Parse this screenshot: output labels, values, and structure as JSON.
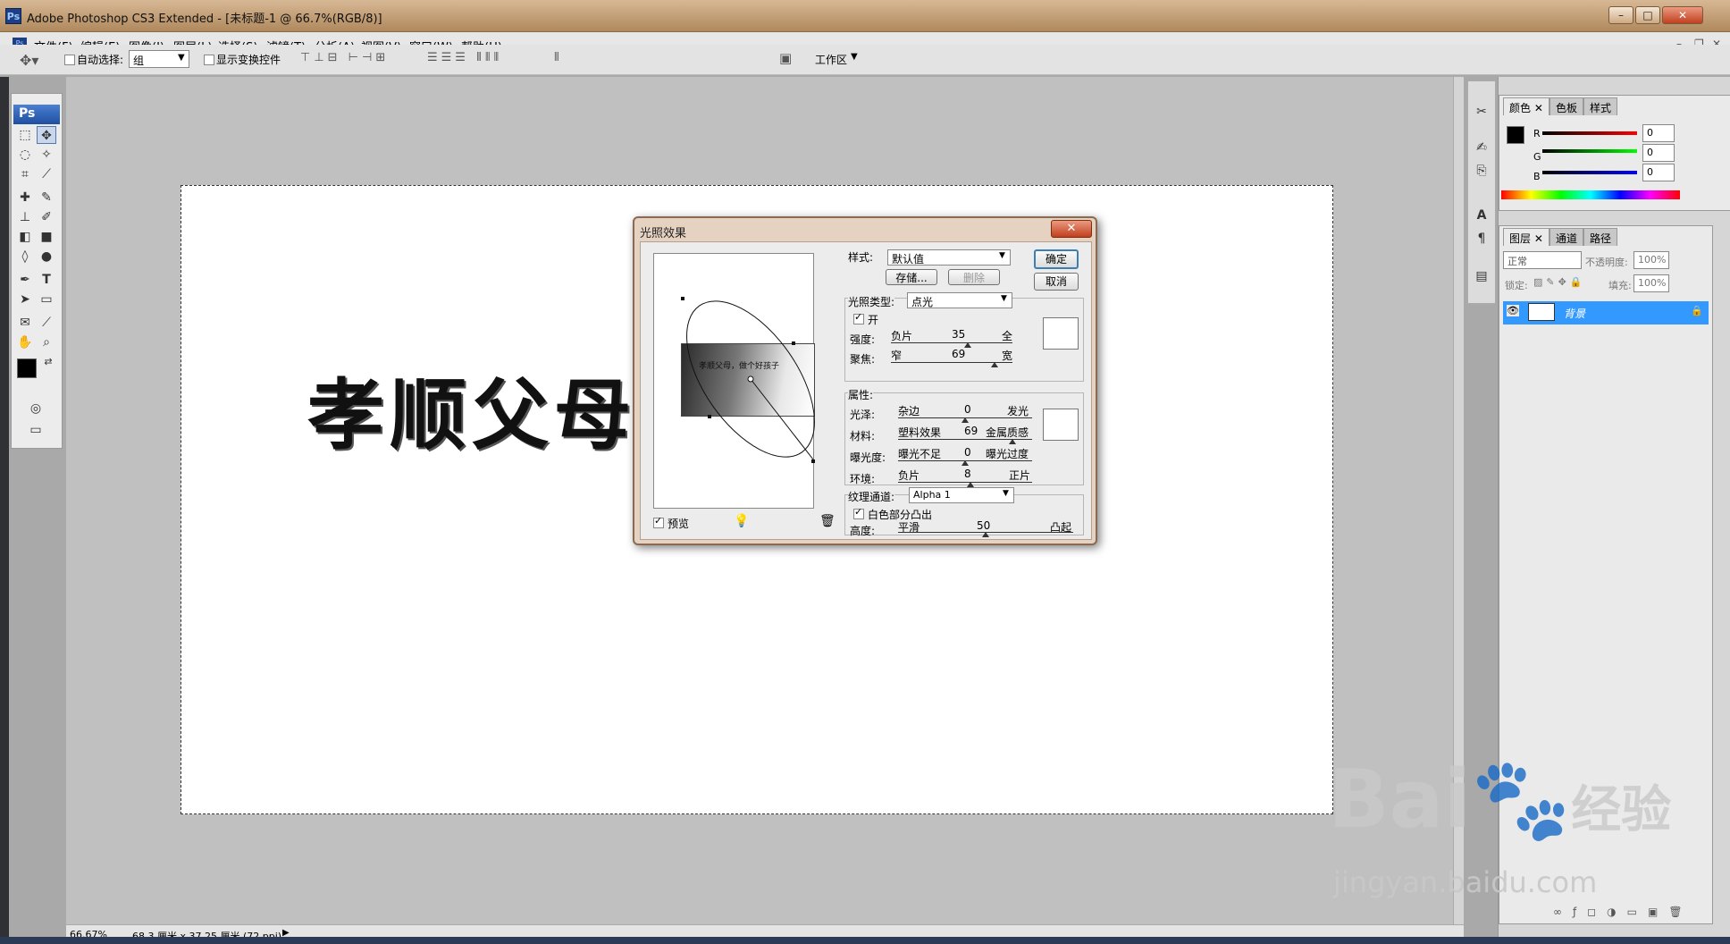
{
  "window": {
    "title": "Adobe Photoshop CS3 Extended - [未标题-1 @ 66.7%(RGB/8)]",
    "min": "–",
    "max": "□",
    "close": "✕"
  },
  "menu": [
    "文件(F)",
    "编辑(E)",
    "图像(I)",
    "图层(L)",
    "选择(S)",
    "滤镜(T)",
    "分析(A)",
    "视图(V)",
    "窗口(W)",
    "帮助(H)"
  ],
  "options": {
    "auto_select_label": "自动选择:",
    "auto_select_value": "组",
    "show_transform_label": "显示变换控件",
    "workspace_label": "工作区"
  },
  "toolbox": {
    "logo": "Ps"
  },
  "document": {
    "text": "孝顺父母"
  },
  "dialog": {
    "title": "光照效果",
    "preview_text": "孝顺父母，做个好孩子",
    "preview_label": "预览",
    "style_label": "样式:",
    "style_value": "默认值",
    "save_button": "存储...",
    "delete_button": "删除",
    "ok_button": "确定",
    "cancel_button": "取消",
    "light_type_label": "光照类型:",
    "light_type_value": "点光",
    "on_label": "开",
    "intensity": {
      "label": "强度:",
      "left": "负片",
      "value": "35",
      "right": "全",
      "fraction": 0.63
    },
    "focus": {
      "label": "聚焦:",
      "left": "窄",
      "value": "69",
      "right": "宽",
      "fraction": 0.85
    },
    "properties_label": "属性:",
    "gloss": {
      "label": "光泽:",
      "left": "杂边",
      "value": "0",
      "right": "发光",
      "fraction": 0.5
    },
    "material": {
      "label": "材料:",
      "left": "塑料效果",
      "value": "69",
      "right": "金属质感",
      "fraction": 0.85
    },
    "exposure": {
      "label": "曝光度:",
      "left": "曝光不足",
      "value": "0",
      "right": "曝光过度",
      "fraction": 0.5
    },
    "ambience": {
      "label": "环境:",
      "left": "负片",
      "value": "8",
      "right": "正片",
      "fraction": 0.54
    },
    "texture_label": "纹理通道:",
    "texture_value": "Alpha 1",
    "white_high_label": "白色部分凸出",
    "height": {
      "label": "高度:",
      "left": "平滑",
      "value": "50",
      "right": "凸起",
      "fraction": 0.5
    }
  },
  "color_panel": {
    "tabs": [
      "颜色",
      "色板",
      "样式"
    ],
    "r_label": "R",
    "r_value": "0",
    "g_label": "G",
    "g_value": "0",
    "b_label": "B",
    "b_value": "0"
  },
  "layers_panel": {
    "tabs": [
      "图层",
      "通道",
      "路径"
    ],
    "blend_mode": "正常",
    "opacity_label": "不透明度:",
    "opacity_value": "100%",
    "lock_label": "锁定:",
    "fill_label": "填充:",
    "fill_value": "100%",
    "layer_name": "背景"
  },
  "status": {
    "zoom": "66.67%",
    "doc_info": "68.3 厘米 x 37.25 厘米 (72 ppi)"
  },
  "watermark": {
    "brand": "Bai",
    "brand2": "经验",
    "url": "jingyan.baidu.com"
  },
  "colors": {
    "highlight": "#3399ff",
    "title_bar": "#c09a70",
    "dialog_bg": "#e6d2c0"
  }
}
